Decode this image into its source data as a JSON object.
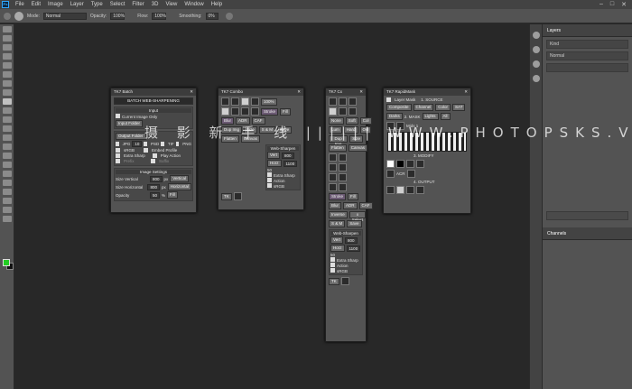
{
  "menubar": {
    "logo": "Ps",
    "items": [
      "File",
      "Edit",
      "Image",
      "Layer",
      "Type",
      "Select",
      "Filter",
      "3D",
      "View",
      "Window",
      "Help"
    ]
  },
  "options": {
    "mode_label": "Mode:",
    "mode_value": "Normal",
    "opacity_label": "Opacity:",
    "opacity_value": "100%",
    "flow_label": "Flow:",
    "flow_value": "100%",
    "smoothing_label": "Smoothing:",
    "smoothing_value": "0%"
  },
  "right_panels": {
    "layers_tab": "Layers",
    "kind_label": "Kind",
    "mode_value": "Normal",
    "channels_tab": "Channels"
  },
  "batch_panel": {
    "title": "TK7 Batch",
    "header": "BATCH WEB-SHARPENING",
    "input_title": "Input",
    "current_image_only": "Current Image Only",
    "input_folder": "Input Folder",
    "output_folder": "Output Folder",
    "formats": [
      "JPG",
      "PSD",
      "TIF",
      "PNG"
    ],
    "jpg_quality": "10",
    "srgb": "sRGB",
    "embed_profile": "Embed Profile",
    "extra_sharp": "Extra Sharp",
    "play_action": "Play Action",
    "prefix": "Prefix",
    "suffix": "Suffix",
    "image_settings_title": "Image Settings",
    "size_vertical_label": "Size Vertical",
    "size_vertical_value": "800",
    "size_horizontal_label": "Size Horizontal",
    "size_horizontal_value": "800",
    "px": "px",
    "vertical_btn": "Vertical",
    "horizontal_btn": "Horizontal",
    "opacity_label": "Opacity",
    "opacity_value": "50",
    "pct": "%",
    "fill_btn": "Fill"
  },
  "combo_panel": {
    "title": "TK7 Combo",
    "pct": "100%",
    "stroke": "Stroke",
    "fill": "Fill",
    "blur": "Blur",
    "adr": "ADR",
    "caf": "CAF",
    "dup_img": "Dup Img",
    "size": "Size",
    "flatten": "Flatten",
    "canvas": "Canvas",
    "sm": "S & M",
    "save": "Save",
    "web_sharpen": "Web-Sharpen",
    "vert": "Vert",
    "vert_val": "800",
    "horz": "Horz",
    "horz_val": "1100",
    "fill_pct": "50",
    "extra_sharp": "Extra Sharp",
    "action": "Action",
    "srgb": "sRGB",
    "tk": "TK"
  },
  "cx_panel": {
    "title": "TK7 Cx",
    "none": "None",
    "soft": "Soft",
    "col": "Col",
    "sat": "Sat",
    "lum": "Lum",
    "hard": "Hard",
    "ovl": "Ovl",
    "mult": "Mult",
    "dup_img": "Dup Img",
    "size": "Size",
    "flatten": "Flatten",
    "canvas": "Canvas",
    "stroke": "Stroke",
    "fill": "Fill",
    "blur": "Blur",
    "adr": "ADR",
    "caf": "CAF",
    "inverse": "Inverse",
    "x_select": "x Select",
    "sm": "S & M",
    "save": "Save",
    "web_sharpen": "Web-Sharpen",
    "vert": "Vert",
    "vert_val": "800",
    "horz": "Horz",
    "horz_val": "1100",
    "fill_pct": "50",
    "extra_sharp": "Extra Sharp",
    "action": "Action",
    "srgb": "sRGB",
    "tk": "TK"
  },
  "rapid_panel": {
    "title": "TK7 RapidMask",
    "layer_mask": "Layer Mask",
    "source_title": "1. SOURCE",
    "composite": "Composite",
    "channel": "Channel",
    "color": "Color",
    "sat": "SAT",
    "mask_title": "2. MASK",
    "darks": "Darks",
    "lights": "Lights",
    "all": "All",
    "mids": "Mids 1",
    "modify_title": "3. MODIFY",
    "output_title": "4. OUTPUT",
    "acr": "ACR"
  },
  "watermark": "摄 影 新 手 线 |||||| WWW.PHOTOPSKS.VIP"
}
